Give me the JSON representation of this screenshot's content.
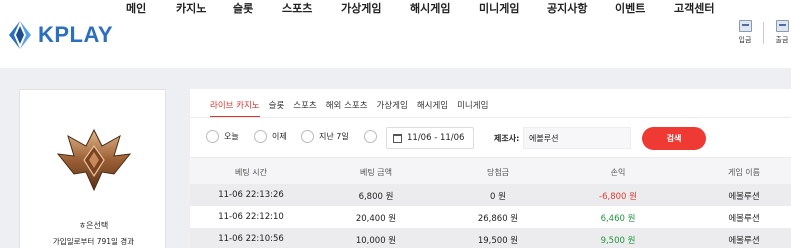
{
  "header": {
    "logo_text": "KPLAY",
    "nav": [
      "메인",
      "카지노",
      "슬롯",
      "스포츠",
      "가상게임",
      "해시게임",
      "미니게임",
      "공지사항",
      "이벤트",
      "고객센터"
    ],
    "deposit_label": "입금",
    "withdraw_label": "출금"
  },
  "user": {
    "name": "ㅎ은선택",
    "since": "가입일로부터 791일 경과"
  },
  "tabs": [
    "라이브 카지노",
    "슬롯",
    "스포츠",
    "해외 스포츠",
    "가상게임",
    "해시게임",
    "미니게임"
  ],
  "active_tab": "라이브 카지노",
  "filters": {
    "today": "오늘",
    "yesterday": "이제",
    "last7": "지난 7일",
    "date_range": "11/06 - 11/06",
    "maker_label": "제조사:",
    "maker_value": "에볼루션",
    "search_label": "검색"
  },
  "table": {
    "headers": [
      "베팅 시간",
      "베팅 금액",
      "당첨금",
      "손익",
      "게임 이름"
    ],
    "rows": [
      {
        "time": "11-06 22:13:26",
        "bet": "6,800 원",
        "win": "0 원",
        "pl": "-6,800 원",
        "pl_sign": "neg",
        "game": "에볼루션"
      },
      {
        "time": "11-06 22:12:10",
        "bet": "20,400 원",
        "win": "26,860 원",
        "pl": "6,460 원",
        "pl_sign": "pos",
        "game": "에볼루션"
      },
      {
        "time": "11-06 22:10:56",
        "bet": "10,000 원",
        "win": "19,500 원",
        "pl": "9,500 원",
        "pl_sign": "pos",
        "game": "에볼루션"
      }
    ]
  },
  "colors": {
    "accent": "#ef3a34",
    "brand": "#2b6fc0",
    "negative": "#e03a30",
    "positive": "#1e9a3c"
  }
}
